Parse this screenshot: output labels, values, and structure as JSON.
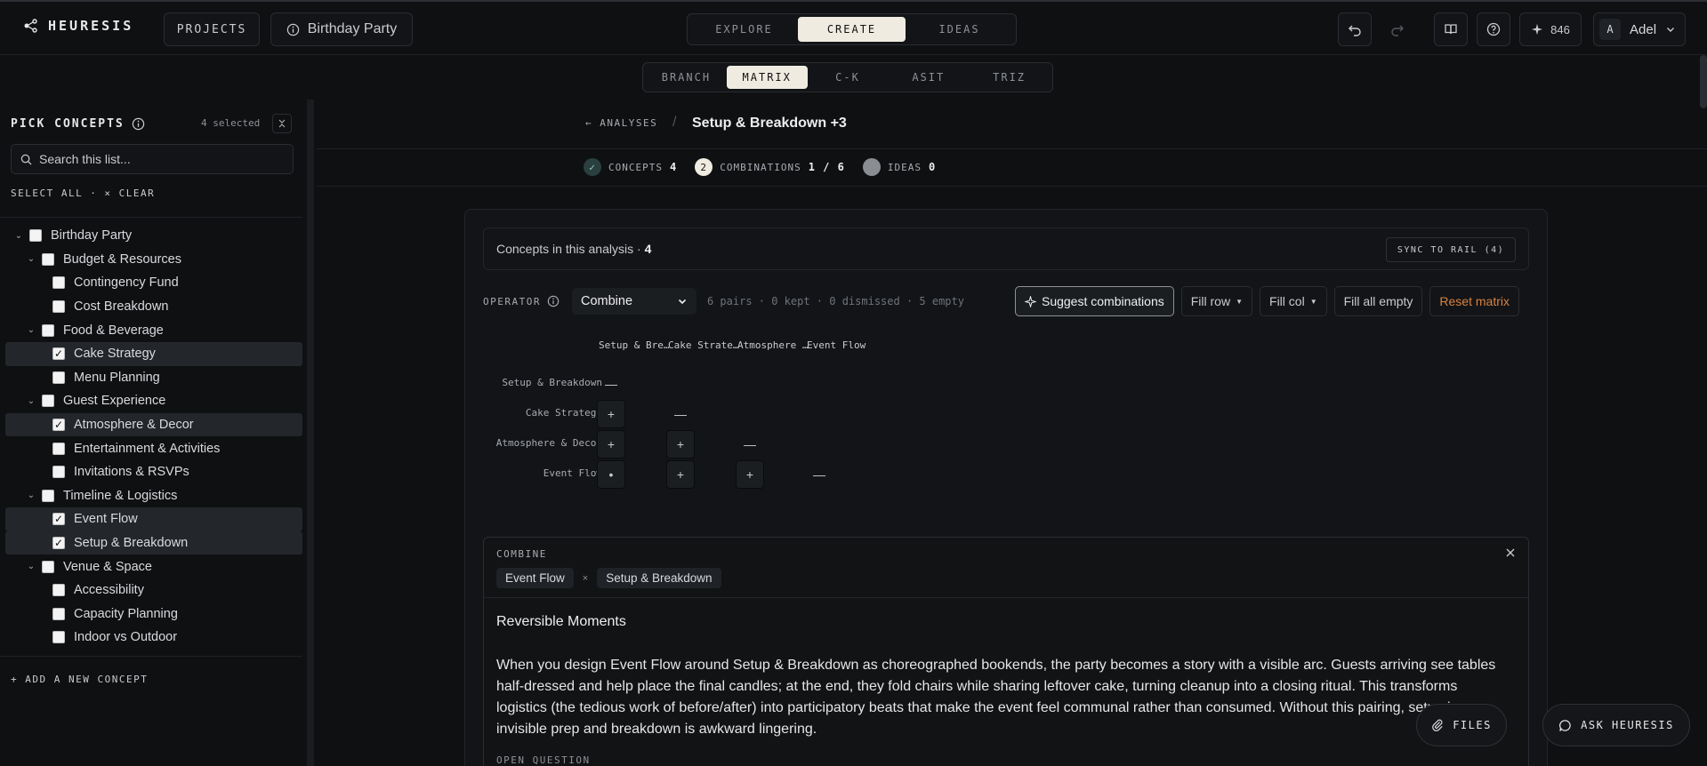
{
  "app": {
    "name": "HEURESIS"
  },
  "topbar": {
    "projects_label": "PROJECTS",
    "breadcrumb_project": "Birthday Party",
    "mode_tabs": [
      {
        "label": "EXPLORE",
        "active": false
      },
      {
        "label": "CREATE",
        "active": true
      },
      {
        "label": "IDEAS",
        "active": false
      }
    ],
    "credits": "846",
    "user": {
      "initial": "A",
      "name": "Adel"
    },
    "icons": [
      "undo-icon",
      "redo-icon",
      "book-icon",
      "help-icon",
      "sparkle-icon"
    ]
  },
  "subtabs": [
    {
      "label": "BRANCH",
      "active": false
    },
    {
      "label": "MATRIX",
      "active": true
    },
    {
      "label": "C-K",
      "active": false
    },
    {
      "label": "ASIT",
      "active": false
    },
    {
      "label": "TRIZ",
      "active": false
    }
  ],
  "sidebar": {
    "title": "PICK CONCEPTS",
    "selected_count": "4 selected",
    "search_placeholder": "Search this list...",
    "select_all": "SELECT ALL",
    "separator": "·",
    "clear": "× CLEAR",
    "add_concept": "+ ADD A NEW CONCEPT",
    "tree": [
      {
        "label": "Birthday Party",
        "level": 0,
        "checked": false,
        "expandable": true
      },
      {
        "label": "Budget & Resources",
        "level": 1,
        "checked": false,
        "expandable": true
      },
      {
        "label": "Contingency Fund",
        "level": 2,
        "checked": false,
        "expandable": false
      },
      {
        "label": "Cost Breakdown",
        "level": 2,
        "checked": false,
        "expandable": false
      },
      {
        "label": "Food & Beverage",
        "level": 1,
        "checked": false,
        "expandable": true
      },
      {
        "label": "Cake Strategy",
        "level": 2,
        "checked": true,
        "expandable": false
      },
      {
        "label": "Menu Planning",
        "level": 2,
        "checked": false,
        "expandable": false
      },
      {
        "label": "Guest Experience",
        "level": 1,
        "checked": false,
        "expandable": true
      },
      {
        "label": "Atmosphere & Decor",
        "level": 2,
        "checked": true,
        "expandable": false
      },
      {
        "label": "Entertainment & Activities",
        "level": 2,
        "checked": false,
        "expandable": false
      },
      {
        "label": "Invitations & RSVPs",
        "level": 2,
        "checked": false,
        "expandable": false
      },
      {
        "label": "Timeline & Logistics",
        "level": 1,
        "checked": false,
        "expandable": true
      },
      {
        "label": "Event Flow",
        "level": 2,
        "checked": true,
        "expandable": false
      },
      {
        "label": "Setup & Breakdown",
        "level": 2,
        "checked": true,
        "expandable": false
      },
      {
        "label": "Venue & Space",
        "level": 1,
        "checked": false,
        "expandable": true
      },
      {
        "label": "Accessibility",
        "level": 2,
        "checked": false,
        "expandable": false
      },
      {
        "label": "Capacity Planning",
        "level": 2,
        "checked": false,
        "expandable": false
      },
      {
        "label": "Indoor vs Outdoor",
        "level": 2,
        "checked": false,
        "expandable": false
      }
    ]
  },
  "header": {
    "back_label": "← ANALYSES",
    "title": "Setup & Breakdown +3"
  },
  "steps": [
    {
      "marker": "✓",
      "label": "CONCEPTS",
      "value": "4",
      "state": "done"
    },
    {
      "marker": "2",
      "label": "COMBINATIONS",
      "value": "1 / 6",
      "state": "current"
    },
    {
      "marker": "",
      "label": "IDEAS",
      "value": "0",
      "state": "todo"
    }
  ],
  "analysis": {
    "concepts_label": "Concepts in this analysis ·",
    "concepts_count": "4",
    "sync_label": "SYNC TO RAIL (4)",
    "operator_label": "OPERATOR",
    "operator_value": "Combine",
    "stats": "6 pairs · 0 kept · 0 dismissed · 5 empty",
    "buttons": {
      "suggest": "Suggest combinations",
      "fill_row": "Fill row",
      "fill_col": "Fill col",
      "fill_all": "Fill all empty",
      "reset": "Reset matrix"
    }
  },
  "matrix": {
    "columns": [
      "Setup & Breakdown",
      "Cake Strategy",
      "Atmosphere & Decor",
      "Event Flow"
    ],
    "rows": [
      "Setup & Breakdown",
      "Cake Strategy",
      "Atmosphere & Decor",
      "Event Flow"
    ],
    "cells": [
      [
        "—",
        "",
        "",
        ""
      ],
      [
        "+",
        "—",
        "",
        ""
      ],
      [
        "+",
        "+",
        "—",
        ""
      ],
      [
        "•",
        "+",
        "+",
        "—"
      ]
    ]
  },
  "combination": {
    "label": "COMBINE",
    "chip_a": "Event Flow",
    "times": "×",
    "chip_b": "Setup & Breakdown",
    "idea_title": "Reversible Moments",
    "idea_body": "When you design Event Flow around Setup & Breakdown as choreographed bookends, the party becomes a story with a visible arc. Guests arriving see tables half-dressed and help place the final candles; at the end, they fold chairs while sharing leftover cake, turning cleanup into a closing ritual. This transforms logistics (the tedious work of before/after) into participatory beats that make the event feel communal rather than consumed. Without this pairing, setup is invisible prep and breakdown is awkward lingering.",
    "open_question_label": "OPEN QUESTION"
  },
  "floating": {
    "files": "FILES",
    "ask": "ASK HEURESIS"
  }
}
